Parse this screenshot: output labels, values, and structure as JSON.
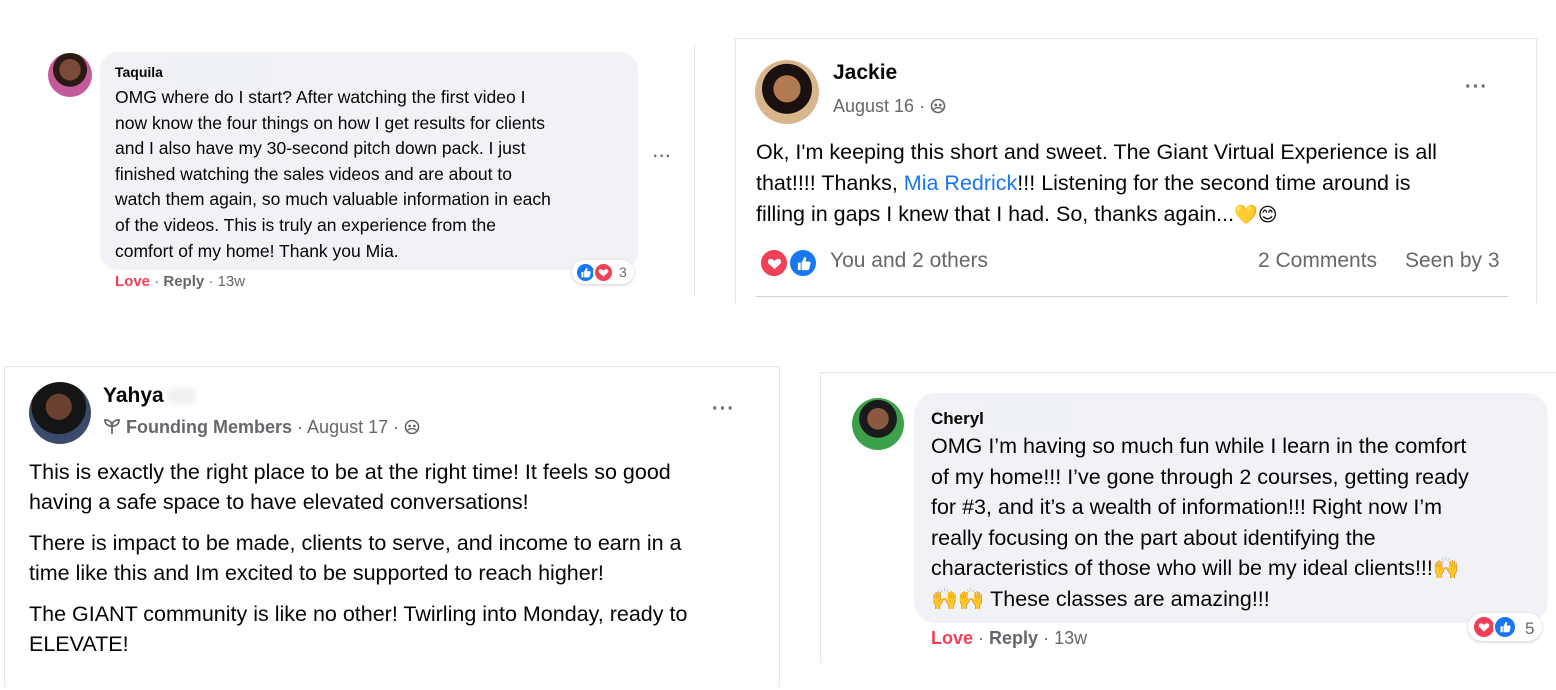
{
  "colors": {
    "love_red": "#f33e58",
    "like_blue": "#1877f2",
    "bubble_bg": "#f0f2f5",
    "meta_gray": "#65676b",
    "link_blue": "#1877f2"
  },
  "comment1": {
    "author": "Taquila",
    "text": "OMG where do I start? After watching the first video I\nnow know the four things on how I get results for clients\nand I also have my 30-second pitch down pack. I just\nfinished watching the sales videos and are about to\nwatch them again, so much valuable information in each\nof the videos. This is truly an experience from the\ncomfort of my home! Thank you Mia.",
    "love_label": "Love",
    "sep1": "·",
    "reply_label": "Reply",
    "sep2": "·",
    "time": "13w",
    "reaction_count": "3",
    "more": "···",
    "icons": [
      "like-icon",
      "love-icon",
      "more-options-icon"
    ]
  },
  "post1": {
    "author": "Jackie",
    "date": "August 16",
    "sep": "·",
    "text_before": "Ok, I'm keeping this short and sweet. The Giant Virtual Experience is all\nthat!!!! Thanks, ",
    "mention": "Mia Redrick",
    "text_after": "!!! Listening for the second time around is\nfilling in gaps I knew that I had. So, thanks again...",
    "emoji": "💛😊",
    "reactions_text": "You and 2 others",
    "comments": "2 Comments",
    "seen": "Seen by 3",
    "more": "···",
    "icons": [
      "group-privacy-icon",
      "love-icon",
      "like-icon"
    ]
  },
  "post2": {
    "author": "Yahya",
    "badge": "Founding Members",
    "sep1": "·",
    "date": "August 17",
    "sep2": "·",
    "paragraphs": [
      "This is exactly the right place to be at the right time! It feels so good\nhaving a safe space to have elevated conversations!",
      "There is impact to be made, clients to serve, and income to earn in a\ntime like this and Im excited to be supported to reach higher!",
      "The GIANT community is like no other! Twirling into Monday, ready to\nELEVATE!"
    ],
    "more": "···",
    "icons": [
      "sprout-icon",
      "group-privacy-icon"
    ]
  },
  "comment2": {
    "author": "Cheryl",
    "text": "OMG I’m having so much fun while I learn in the comfort\nof my home!!! I’ve gone through 2 courses, getting ready\nfor #3, and it’s a wealth of information!!! Right now I’m\nreally focusing on the part about identifying the\ncharacteristics of those who will be my ideal clients!!!🙌\n🙌🙌 These classes are amazing!!!",
    "love_label": "Love",
    "sep1": "·",
    "reply_label": "Reply",
    "sep2": "·",
    "time": "13w",
    "reaction_count": "5",
    "icons": [
      "love-icon",
      "like-icon"
    ]
  }
}
